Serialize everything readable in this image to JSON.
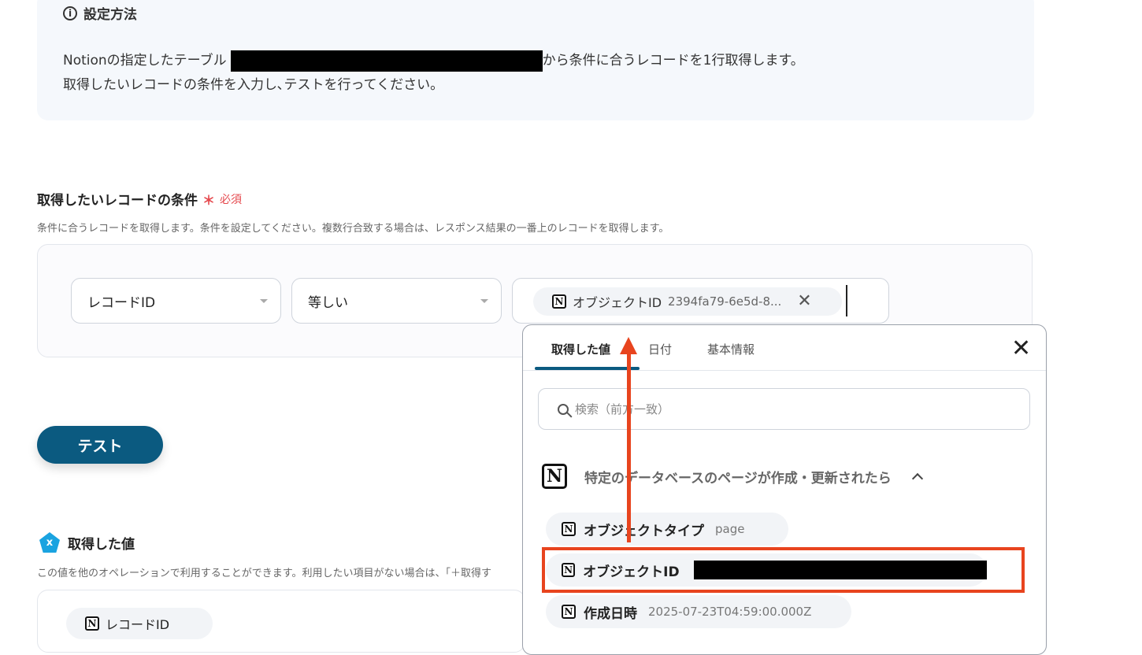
{
  "info": {
    "title": "設定方法",
    "line1_prefix": "Notionの指定したテーブル（",
    "line1_suffix": "から条件に合うレコードを1行取得します。",
    "line2": "取得したいレコードの条件を入力し､テストを行ってください。"
  },
  "condition": {
    "title": "取得したいレコードの条件",
    "required_mark": "＊",
    "required_label": "必須",
    "description": "条件に合うレコードを取得します。条件を設定してください。複数行合致する場合は、レスポンス結果の一番上のレコードを取得します。",
    "field_select": "レコードID",
    "operator_select": "等しい",
    "value_chip": {
      "label": "オブジェクトID",
      "value": "2394fa79-6e5d-8..."
    }
  },
  "test_button": "テスト",
  "retrieved": {
    "title": "取得した値",
    "description": "この値を他のオペレーションで利用することができます。利用したい項目がない場合は、「＋取得す",
    "first_item": "レコードID"
  },
  "popup": {
    "tabs": [
      "取得した値",
      "日付",
      "基本情報"
    ],
    "active_tab": 0,
    "search_placeholder": "検索（前方一致）",
    "group_title": "特定のデータベースのページが作成・更新されたら",
    "items": [
      {
        "label": "オブジェクトタイプ",
        "value": "page"
      },
      {
        "label": "オブジェクトID",
        "value": ""
      },
      {
        "label": "作成日時",
        "value": "2025-07-23T04:59:00.000Z"
      }
    ]
  },
  "colors": {
    "accent": "#0b5a80",
    "annotation": "#e8441e",
    "required": "#e5484d"
  }
}
